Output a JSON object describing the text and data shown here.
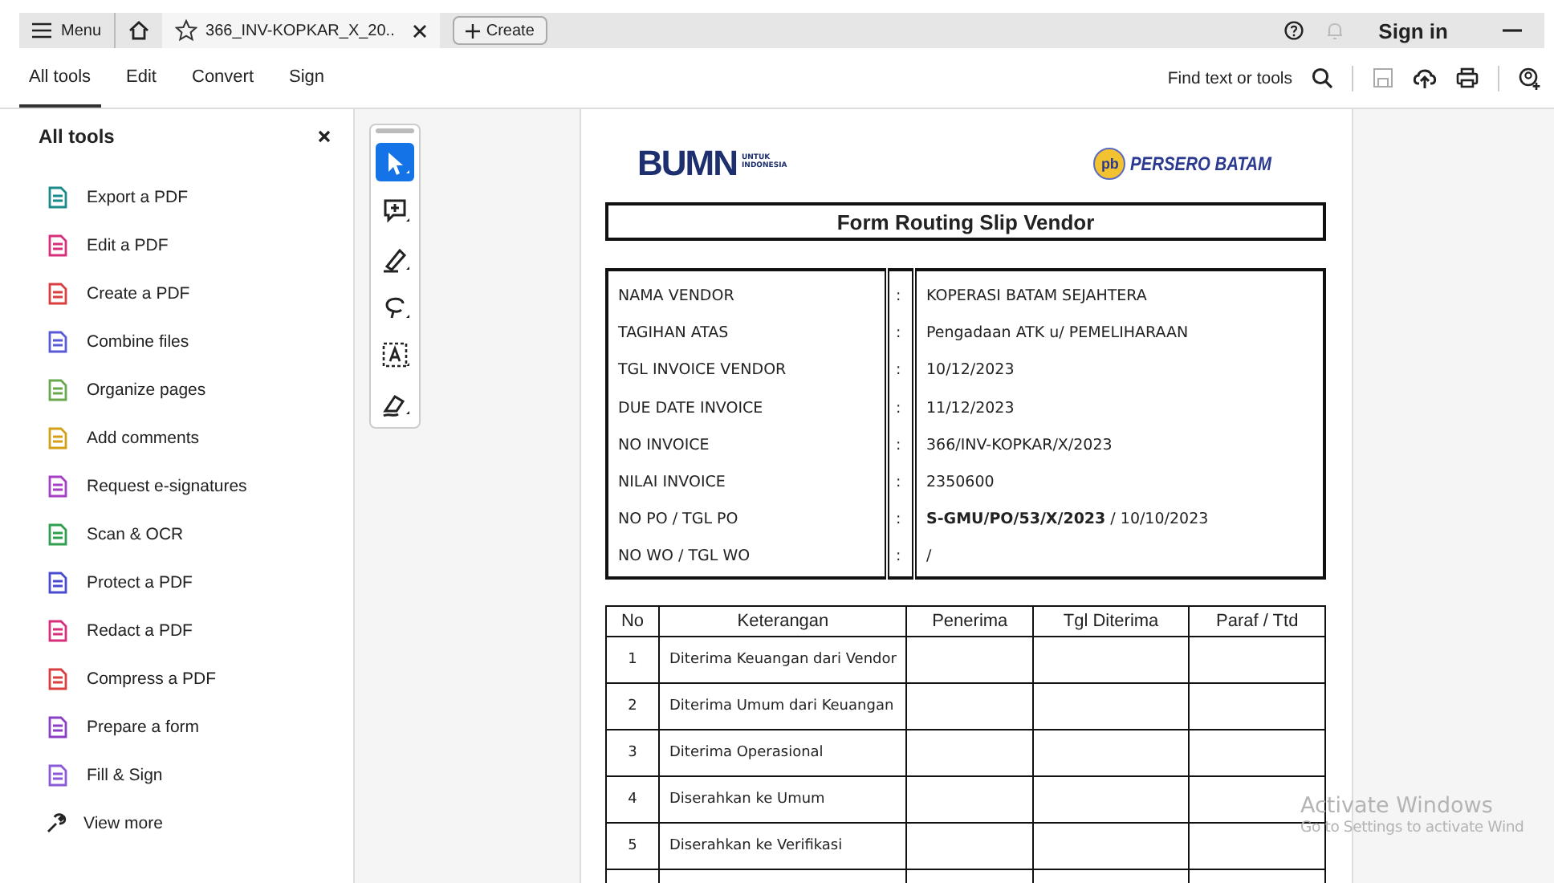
{
  "title_bar": {
    "menu": "Menu",
    "tab_title": "366_INV-KOPKAR_X_20..",
    "create": "Create",
    "sign_in": "Sign in"
  },
  "toolbar": {
    "tabs": [
      {
        "label": "All tools",
        "selected": true
      },
      {
        "label": "Edit",
        "selected": false
      },
      {
        "label": "Convert",
        "selected": false
      },
      {
        "label": "Sign",
        "selected": false
      }
    ],
    "find": "Find text or tools"
  },
  "sidebar": {
    "title": "All tools",
    "items": [
      {
        "label": "Export a PDF",
        "color": "#1a8a8a"
      },
      {
        "label": "Edit a PDF",
        "color": "#d6307a"
      },
      {
        "label": "Create a PDF",
        "color": "#d93f3f"
      },
      {
        "label": "Combine files",
        "color": "#5a5ad6"
      },
      {
        "label": "Organize pages",
        "color": "#6aa84f"
      },
      {
        "label": "Add comments",
        "color": "#d4a017"
      },
      {
        "label": "Request e-signatures",
        "color": "#a53fc4"
      },
      {
        "label": "Scan & OCR",
        "color": "#2f9e4f"
      },
      {
        "label": "Protect a PDF",
        "color": "#4a4ad0"
      },
      {
        "label": "Redact a PDF",
        "color": "#d6307a"
      },
      {
        "label": "Compress a PDF",
        "color": "#d93f3f"
      },
      {
        "label": "Prepare a form",
        "color": "#8a3fc4"
      },
      {
        "label": "Fill & Sign",
        "color": "#8a5ad6"
      }
    ],
    "more": "View more"
  },
  "quick_tools": [
    {
      "kind": "select",
      "selected": true
    },
    {
      "kind": "comment",
      "selected": false
    },
    {
      "kind": "highlight",
      "selected": false
    },
    {
      "kind": "draw",
      "selected": false
    },
    {
      "kind": "text",
      "selected": false
    },
    {
      "kind": "sign",
      "selected": false
    }
  ],
  "document": {
    "logo_left": {
      "mark": "BUMN",
      "line1": "UNTUK",
      "line2": "INDONESIA"
    },
    "logo_right": {
      "badge": "pb",
      "text": "PERSERO BATAM"
    },
    "title": "Form Routing Slip Vendor",
    "info": [
      {
        "label": "NAMA VENDOR",
        "sep": ":",
        "value": "KOPERASI BATAM SEJAHTERA"
      },
      {
        "label": "TAGIHAN ATAS",
        "sep": ":",
        "value": "Pengadaan ATK u/ PEMELIHARAAN"
      },
      {
        "label": "TGL INVOICE VENDOR",
        "sep": ":",
        "value": "10/12/2023"
      },
      {
        "label": "DUE DATE  INVOICE",
        "sep": ":",
        "value": "11/12/2023"
      },
      {
        "label": "NO INVOICE",
        "sep": ":",
        "value": "366/INV-KOPKAR/X/2023"
      },
      {
        "label": "NILAI INVOICE",
        "sep": ":",
        "value": "2350600"
      },
      {
        "label": "NO PO / TGL PO",
        "sep": ":",
        "value": "**S-GMU/PO/53/X/2023** / 10/10/2023"
      },
      {
        "label": "NO WO / TGL WO",
        "sep": ":",
        "value": "/"
      }
    ],
    "routing": {
      "columns": [
        "No",
        "Keterangan",
        "Penerima",
        "Tgl Diterima",
        "Paraf / Ttd"
      ],
      "rows": [
        {
          "no": "1",
          "keterangan": "Diterima Keuangan dari Vendor"
        },
        {
          "no": "2",
          "keterangan": "Diterima Umum dari Keuangan"
        },
        {
          "no": "3",
          "keterangan": "Diterima Operasional"
        },
        {
          "no": "4",
          "keterangan": "Diserahkan ke Umum"
        },
        {
          "no": "5",
          "keterangan": "Diserahkan ke Verifikasi"
        }
      ]
    }
  },
  "os_notice": {
    "title": "Activate Windows",
    "subtitle": "Go to Settings to activate Wind"
  }
}
